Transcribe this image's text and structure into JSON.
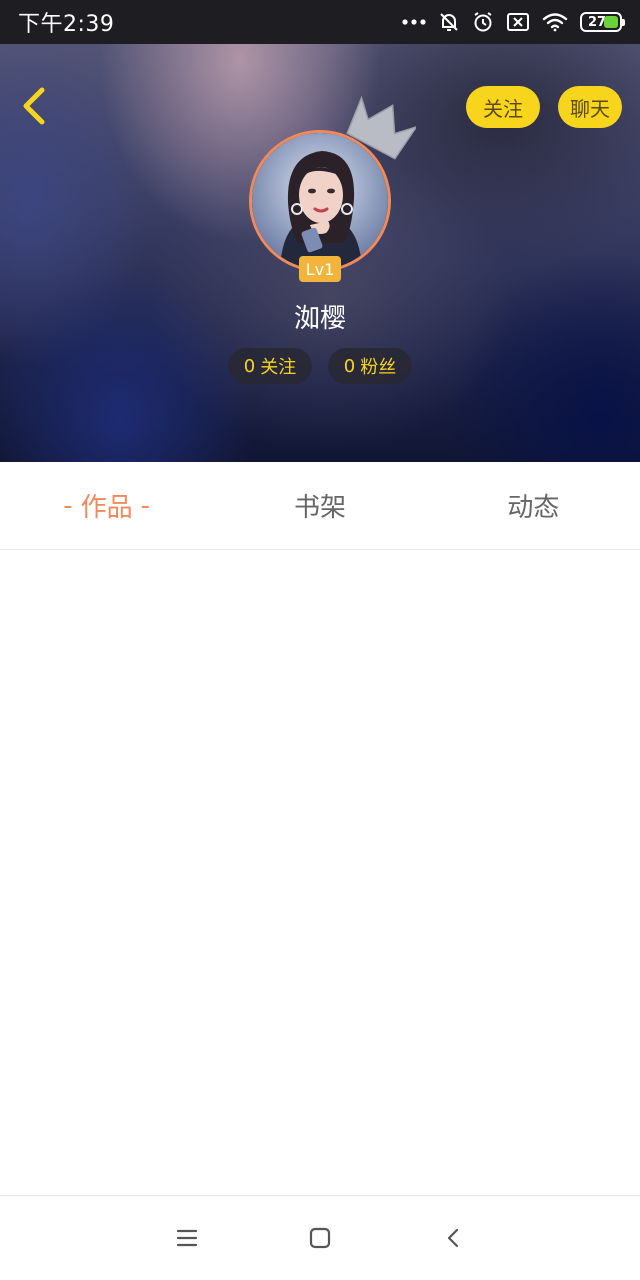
{
  "status_bar": {
    "time": "下午2:39",
    "battery_level": "27",
    "icons": [
      "more-dots-icon",
      "bell-muted-icon",
      "alarm-icon",
      "sim-off-icon",
      "wifi-icon",
      "battery-icon"
    ]
  },
  "header": {
    "back_icon": "chevron-left-icon",
    "follow_label": "关注",
    "chat_label": "聊天",
    "accent_color": "#f7d51d"
  },
  "profile": {
    "avatar": "avatar-photo",
    "crown_icon": "crown-icon",
    "level": "Lv1",
    "username": "洳樱",
    "following_count": "0",
    "following_label": "关注",
    "fans_count": "0",
    "fans_label": "粉丝"
  },
  "tabs": [
    {
      "label": "作品",
      "active": true,
      "dash": "-"
    },
    {
      "label": "书架",
      "active": false
    },
    {
      "label": "动态",
      "active": false
    }
  ],
  "nav_bar": {
    "icons": [
      "menu-icon",
      "home-square-icon",
      "back-chevron-icon"
    ]
  },
  "colors": {
    "active_tab": "#f08a5b",
    "level_badge": "#f2b43b",
    "pill_yellow": "#f7d51d"
  }
}
